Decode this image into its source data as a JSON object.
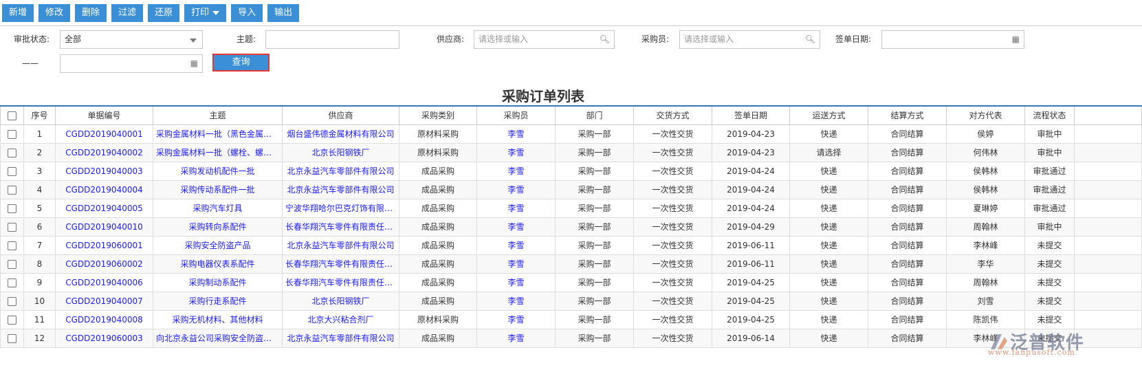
{
  "toolbar": {
    "buttons": [
      "新增",
      "修改",
      "删除",
      "过滤",
      "还原",
      "打印",
      "导入",
      "输出"
    ]
  },
  "filters": {
    "status_label": "审批状态:",
    "status_value": "全部",
    "subject_label": "主题:",
    "subject_value": "",
    "supplier_label": "供应商:",
    "supplier_placeholder": "请选择或输入",
    "buyer_label": "采购员:",
    "buyer_placeholder": "请选择或输入",
    "date_label": "签单日期:",
    "date_sep": "——",
    "query_label": "查询"
  },
  "page_title": "采购订单列表",
  "table": {
    "columns": [
      "序号",
      "单据编号",
      "主题",
      "供应商",
      "采购类别",
      "采购员",
      "部门",
      "交货方式",
      "签单日期",
      "运送方式",
      "结算方式",
      "对方代表",
      "流程状态"
    ],
    "rows": [
      [
        "1",
        "CGDD2019040001",
        "采购金属材料一批（黑色金属材料）",
        "烟台盛伟德金属材料有限公司",
        "原材料采购",
        "李雪",
        "采购一部",
        "一次性交货",
        "2019-04-23",
        "快递",
        "合同结算",
        "侯婷",
        "审批中"
      ],
      [
        "2",
        "CGDD2019040002",
        "采购金属材料一批（螺栓、螺母）",
        "北京长阳钢铁厂",
        "原材料采购",
        "李雪",
        "采购一部",
        "一次性交货",
        "2019-04-23",
        "请选择",
        "合同结算",
        "何伟林",
        "审批中"
      ],
      [
        "3",
        "CGDD2019040003",
        "采购发动机配件一批",
        "北京永益汽车零部件有限公司",
        "成品采购",
        "李雪",
        "采购一部",
        "一次性交货",
        "2019-04-24",
        "快递",
        "合同结算",
        "侯韩林",
        "审批通过"
      ],
      [
        "4",
        "CGDD2019040004",
        "采购传动系配件一批",
        "北京永益汽车零部件有限公司",
        "成品采购",
        "李雪",
        "采购一部",
        "一次性交货",
        "2019-04-24",
        "快递",
        "合同结算",
        "侯韩林",
        "审批通过"
      ],
      [
        "5",
        "CGDD2019040005",
        "采购汽车灯具",
        "宁波华翔哈尔巴克灯饰有限公司",
        "成品采购",
        "李雪",
        "采购一部",
        "一次性交货",
        "2019-04-24",
        "快递",
        "合同结算",
        "夏琳婷",
        "审批通过"
      ],
      [
        "6",
        "CGDD2019040010",
        "采购转向系配件",
        "长春华翔汽车零件有限责任公司",
        "成品采购",
        "李雪",
        "采购一部",
        "一次性交货",
        "2019-04-29",
        "快递",
        "合同结算",
        "周翰林",
        "审批中"
      ],
      [
        "7",
        "CGDD2019060001",
        "采购安全防盗产品",
        "北京永益汽车零部件有限公司",
        "成品采购",
        "李雪",
        "采购一部",
        "一次性交货",
        "2019-06-11",
        "快递",
        "合同结算",
        "李林峰",
        "未提交"
      ],
      [
        "8",
        "CGDD2019060002",
        "采购电器仪表系配件",
        "长春华翔汽车零件有限责任公司",
        "成品采购",
        "李雪",
        "采购一部",
        "一次性交货",
        "2019-06-11",
        "快递",
        "合同结算",
        "李华",
        "未提交"
      ],
      [
        "9",
        "CGDD2019040006",
        "采购制动系配件",
        "长春华翔汽车零件有限责任公司",
        "成品采购",
        "李雪",
        "采购一部",
        "一次性交货",
        "2019-04-25",
        "快递",
        "合同结算",
        "周翰林",
        "未提交"
      ],
      [
        "10",
        "CGDD2019040007",
        "采购行走系配件",
        "北京长阳钢铁厂",
        "成品采购",
        "李雪",
        "采购一部",
        "一次性交货",
        "2019-04-25",
        "快递",
        "合同结算",
        "刘雪",
        "未提交"
      ],
      [
        "11",
        "CGDD2019040008",
        "采购无机材料、其他材料",
        "北京大兴粘合剂厂",
        "原材料采购",
        "李雪",
        "采购一部",
        "一次性交货",
        "2019-04-25",
        "快递",
        "合同结算",
        "陈凯伟",
        "未提交"
      ],
      [
        "12",
        "CGDD2019060003",
        "向北京永益公司采购安全防盗产品",
        "北京永益汽车零部件有限公司",
        "成品采购",
        "李雪",
        "采购一部",
        "一次性交货",
        "2019-06-14",
        "快递",
        "合同结算",
        "李林峰",
        "未提交"
      ]
    ]
  },
  "watermark": {
    "brand": "泛普软件",
    "url": "www.fanpusoft.com"
  },
  "colors": {
    "accent": "#3a8fd6",
    "link": "#1a1aff",
    "highlight": "#e33333"
  }
}
